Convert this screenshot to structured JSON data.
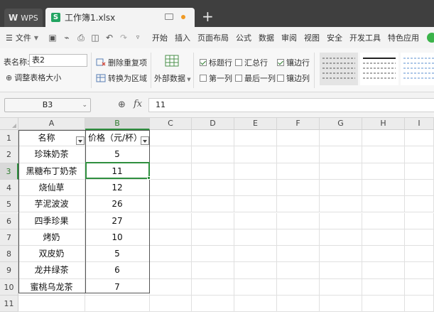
{
  "tabs": {
    "wps_label": "WPS",
    "doc_icon_letter": "S",
    "doc_title": "工作簿1.xlsx",
    "new_tab": "+"
  },
  "menu": {
    "file": "文件",
    "items": [
      "开始",
      "插入",
      "页面布局",
      "公式",
      "数据",
      "审阅",
      "视图",
      "安全",
      "开发工具",
      "特色应用"
    ]
  },
  "ribbon": {
    "table_name_label": "表名称:",
    "table_name_value": "表2",
    "resize_table": "调整表格大小",
    "remove_duplicates": "删除重复项",
    "convert_to_range": "转换为区域",
    "external_data": "外部数据",
    "header_row": "标题行",
    "total_row": "汇总行",
    "banded_rows": "镶边行",
    "first_column": "第一列",
    "last_column": "最后一列",
    "banded_columns": "镶边列",
    "header_row_checked": true,
    "banded_rows_checked": true
  },
  "formula_bar": {
    "cell_ref": "B3",
    "fx": "fx",
    "value": "11"
  },
  "grid": {
    "columns": [
      "A",
      "B",
      "C",
      "D",
      "E",
      "F",
      "G",
      "H",
      "I"
    ],
    "rows": [
      "1",
      "2",
      "3",
      "4",
      "5",
      "6",
      "7",
      "8",
      "9",
      "10",
      "11"
    ],
    "header": [
      "名称",
      "价格（元/杯）"
    ],
    "data": [
      [
        "珍珠奶茶",
        "5"
      ],
      [
        "黑糖布丁奶茶",
        "11"
      ],
      [
        "烧仙草",
        "12"
      ],
      [
        "芋泥波波",
        "26"
      ],
      [
        "四季珍果",
        "27"
      ],
      [
        "烤奶",
        "10"
      ],
      [
        "双皮奶",
        "5"
      ],
      [
        "龙井绿茶",
        "6"
      ],
      [
        "蜜桃乌龙茶",
        "7"
      ]
    ],
    "selected_cell": "B3"
  },
  "colors": {
    "accent_green": "#2f8f3f",
    "tab_bar": "#3f3f3f",
    "doc_icon": "#22a461",
    "unsaved_dot": "#f09a24"
  }
}
